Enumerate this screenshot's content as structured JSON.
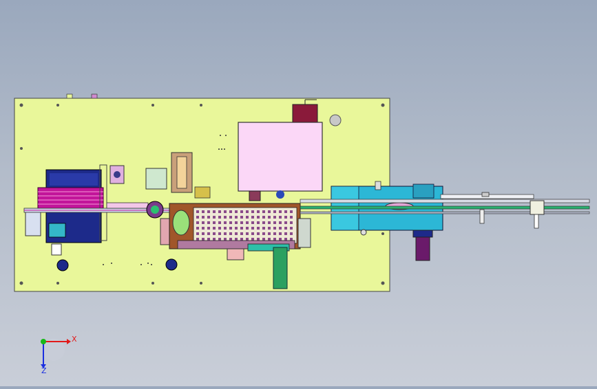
{
  "viewport": {
    "background_top": "#9aa8bd",
    "background_bottom": "#c9ced8"
  },
  "model": {
    "plate_color": "#e9f79a",
    "cabinet_color": "#fbd7f7",
    "blue_color": "#1d2a8a",
    "magenta_color": "#c2149a",
    "cyan_block_color": "#2cb7d6",
    "brown_color": "#c9a07a"
  },
  "triad": {
    "x_label": "X",
    "z_label": "Z",
    "x_color": "#e21a1a",
    "y_color": "#18b818",
    "z_color": "#1a2ee0"
  }
}
